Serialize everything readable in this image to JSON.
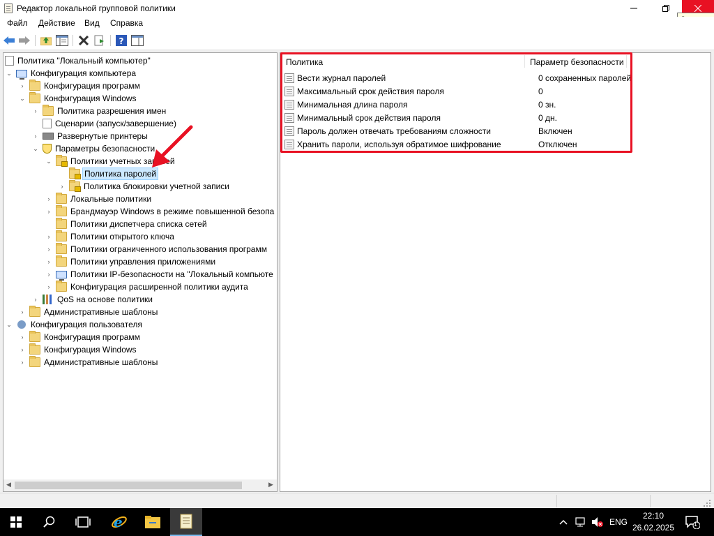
{
  "window": {
    "title": "Редактор локальной групповой политики",
    "close_tooltip": "Закрыть"
  },
  "menu": [
    "Файл",
    "Действие",
    "Вид",
    "Справка"
  ],
  "tree": {
    "root": "Политика \"Локальный компьютер\"",
    "items": [
      "Конфигурация компьютера",
      "Конфигурация программ",
      "Конфигурация Windows",
      "Политика разрешения имен",
      "Сценарии (запуск/завершение)",
      "Развернутые принтеры",
      "Параметры безопасности",
      "Политики учетных записей",
      "Политика паролей",
      "Политика блокировки учетной записи",
      "Локальные политики",
      "Брандмауэр Windows в режиме повышенной безопа",
      "Политики диспетчера списка сетей",
      "Политики открытого ключа",
      "Политики ограниченного использования программ",
      "Политики управления приложениями",
      "Политики IP-безопасности на \"Локальный компьюте",
      "Конфигурация расширенной политики аудита",
      "QoS на основе политики",
      "Административные шаблоны",
      "Конфигурация пользователя",
      "Конфигурация программ",
      "Конфигурация Windows",
      "Административные шаблоны"
    ]
  },
  "list": {
    "col_policy": "Политика",
    "col_setting": "Параметр безопасности",
    "rows": [
      {
        "name": "Вести журнал паролей",
        "value": "0 сохраненных паролей"
      },
      {
        "name": "Максимальный срок действия пароля",
        "value": "0"
      },
      {
        "name": "Минимальная длина пароля",
        "value": "0 зн."
      },
      {
        "name": "Минимальный срок действия пароля",
        "value": "0 дн."
      },
      {
        "name": "Пароль должен отвечать требованиям сложности",
        "value": "Включен"
      },
      {
        "name": "Хранить пароли, используя обратимое шифрование",
        "value": "Отключен"
      }
    ]
  },
  "taskbar": {
    "language": "ENG",
    "time": "22:10",
    "date": "26.02.2025",
    "notification_count": "1"
  },
  "colors": {
    "highlight": "#e81123",
    "selection": "#cce8ff",
    "folder": "#f3d57c"
  }
}
